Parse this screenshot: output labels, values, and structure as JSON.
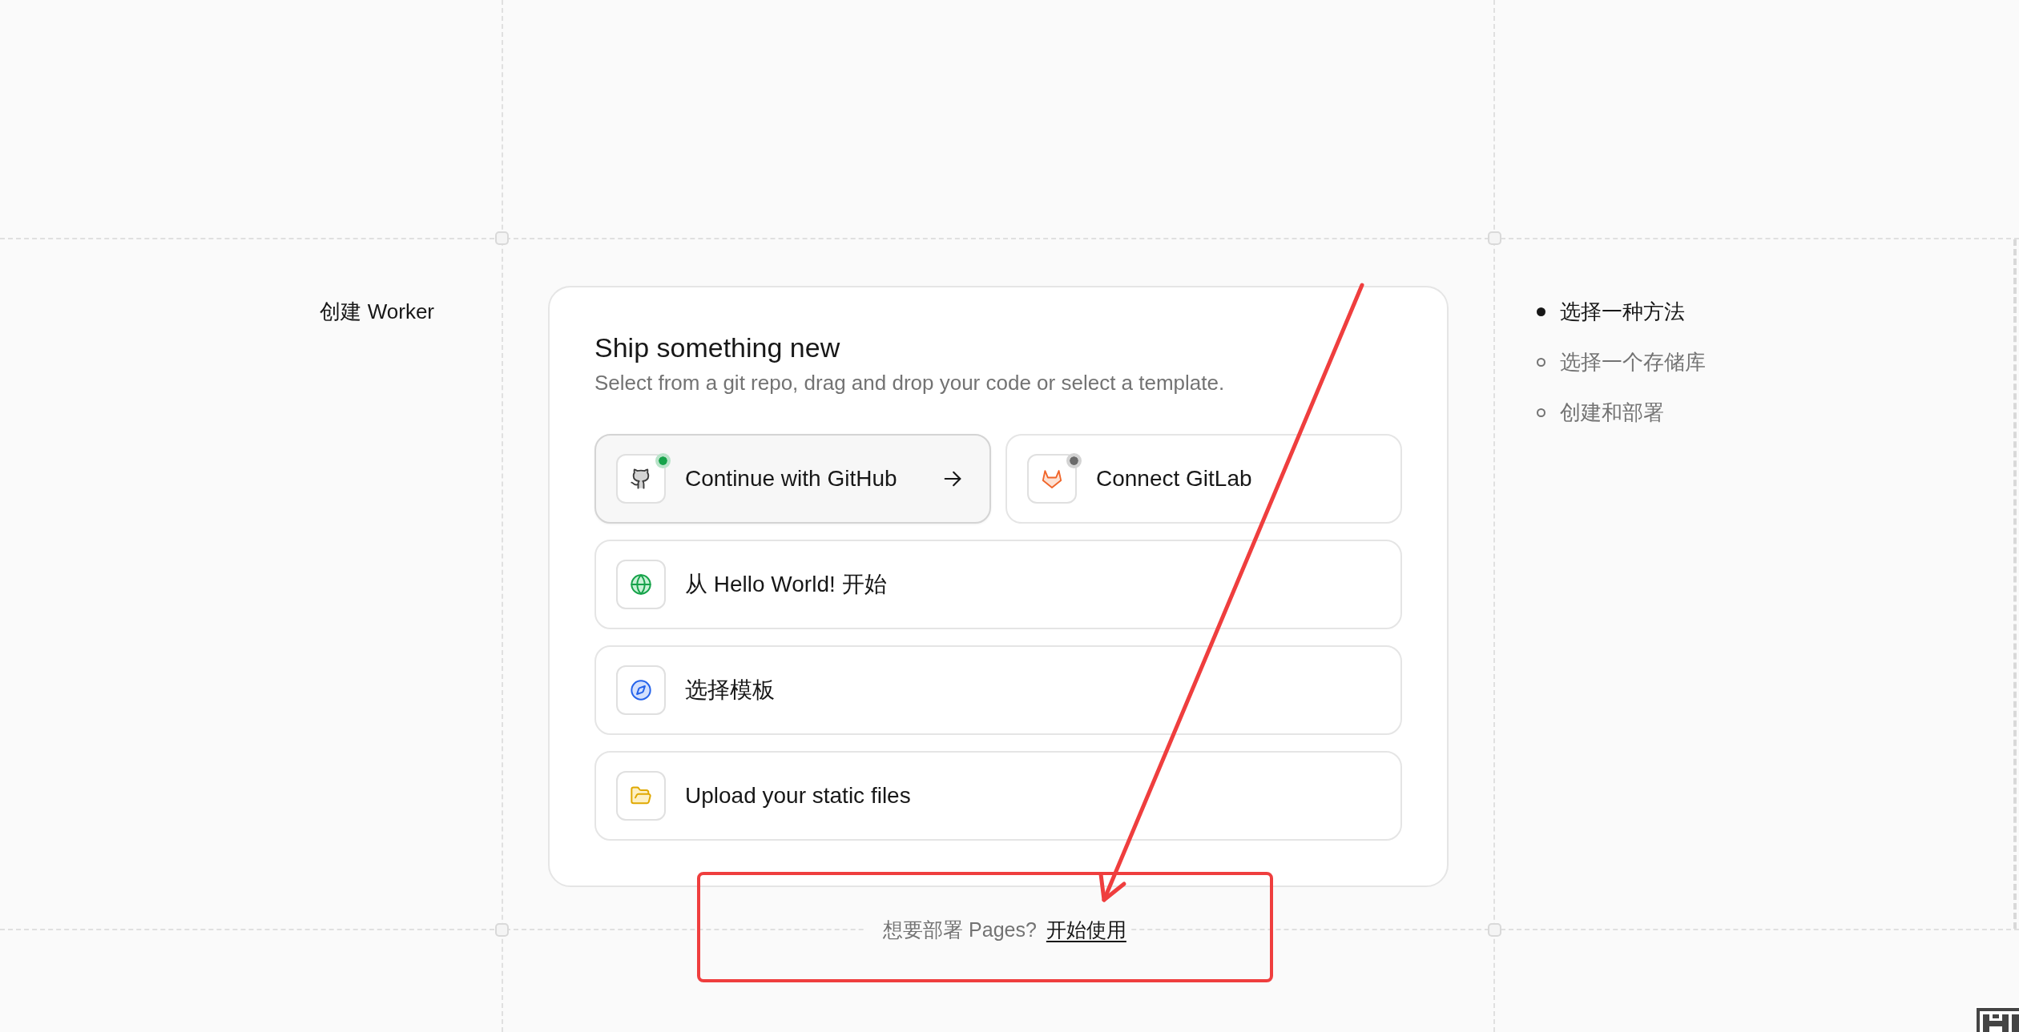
{
  "heading": "创建 Worker",
  "card": {
    "title": "Ship something new",
    "subtitle": "Select from a git repo, drag and drop your code or select a template.",
    "option_rows": [
      {
        "options": [
          {
            "kind": "github",
            "label": "Continue with GitHub",
            "selected": true,
            "color": "#16a34a"
          },
          {
            "kind": "gitlab",
            "label": "Connect GitLab",
            "selected": false,
            "color": "#6b6b6b"
          }
        ]
      },
      {
        "options": [
          {
            "kind": "globe",
            "label": "从 Hello World! 开始",
            "selected": false
          }
        ]
      },
      {
        "options": [
          {
            "kind": "compass",
            "label": "选择模板",
            "selected": false
          }
        ]
      },
      {
        "options": [
          {
            "kind": "folder",
            "label": "Upload your static files",
            "selected": false
          }
        ]
      }
    ]
  },
  "footer": {
    "text": "想要部署 Pages?",
    "link": "开始使用"
  },
  "steps": [
    {
      "label": "选择一种方法",
      "current": true
    },
    {
      "label": "选择一个存储库",
      "current": false
    },
    {
      "label": "创建和部署",
      "current": false
    }
  ]
}
